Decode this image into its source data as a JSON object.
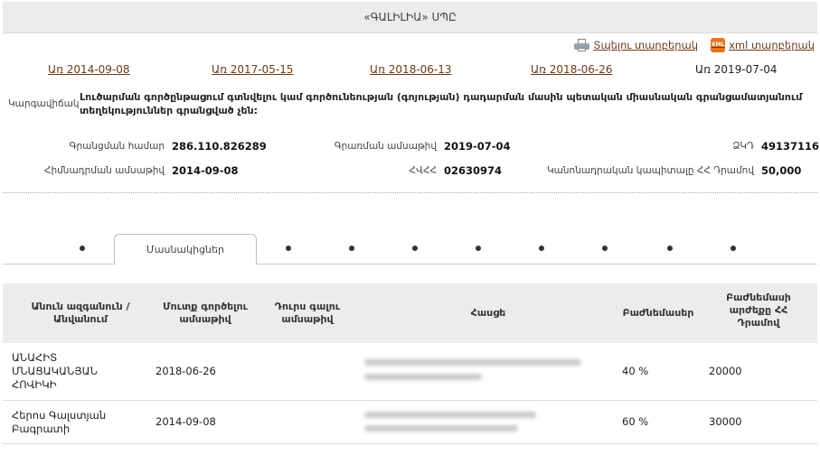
{
  "page": {
    "title": "«ԳԱԼԻԼԻԱ» ՍՊԸ"
  },
  "actions": {
    "print_label": "Տպելու տարբերակ",
    "xml_label": "xml տարբերակ",
    "xml_icon_text": "XML"
  },
  "dates": {
    "links": [
      "Առ 2014-09-08",
      "Առ 2017-05-15",
      "Առ 2018-06-13",
      "Առ 2018-06-26"
    ],
    "current": "Առ 2019-07-04"
  },
  "status": {
    "label": "Կարգավիճակ",
    "text": "Լուծարման գործընթացում գտնվելու կամ գործունեության (գոյության) դադարման մասին պետական միասնական գրանցամատյանում տեղեկություններ գրանցված չեն:"
  },
  "info": {
    "reg_number_label": "Գրանցման համար",
    "reg_number": "286.110.826289",
    "record_date_label": "Գրառման ամսաթիվ",
    "record_date": "2019-07-04",
    "zkd_label": "ՁԿԴ",
    "zkd": "49137116",
    "founding_date_label": "Հիմնադրման ամսաթիվ",
    "founding_date": "2014-09-08",
    "hvhh_label": "ՀՎՀՀ",
    "hvhh": "02630974",
    "capital_label": "Կանոնադրական կապիտալը ՀՀ Դրամով",
    "capital": "50,000"
  },
  "tabs": {
    "active_label": "Մասնակիցներ",
    "other_count": 9
  },
  "table": {
    "headers": {
      "name": "Անուն ազգանուն / Անվանում",
      "entry_date": "Մուտք գործելու ամսաթիվ",
      "exit_date": "Դուրս գալու ամսաթիվ",
      "address": "Հասցե",
      "share": "Բաժնեմասեր",
      "share_value": "Բաժնեմասի արժեքը ՀՀ Դրամով"
    },
    "rows": [
      {
        "name": "ԱՆԱՀԻՏ ՄՆԱՑԱԿԱՆՅԱՆ ՀՈՎԻԿԻ",
        "entry_date": "2018-06-26",
        "exit_date": "",
        "share": "40 %",
        "share_value": "20000"
      },
      {
        "name": "Հերոս Գալստյան Բագրատի",
        "entry_date": "2014-09-08",
        "exit_date": "",
        "share": "60 %",
        "share_value": "30000"
      }
    ]
  }
}
